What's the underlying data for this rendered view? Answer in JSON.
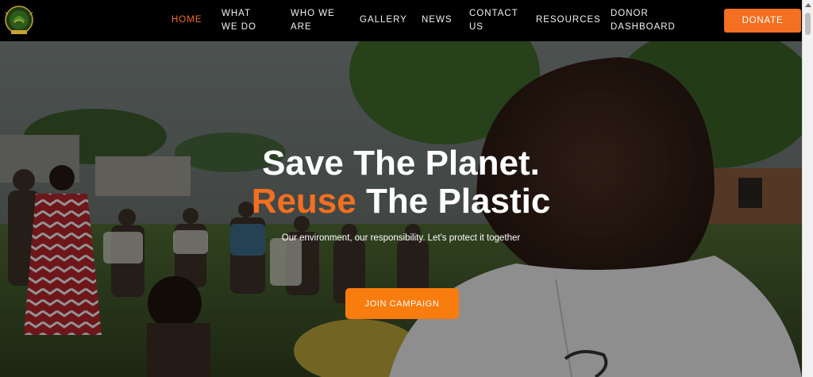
{
  "nav": {
    "items": [
      {
        "label": "HOME",
        "active": true
      },
      {
        "label": "WHAT WE DO"
      },
      {
        "label": "WHO WE ARE"
      },
      {
        "label": "GALLERY"
      },
      {
        "label": "NEWS"
      },
      {
        "label": "CONTACT US"
      },
      {
        "label": "RESOURCES"
      },
      {
        "label": "DONOR DASHBOARD"
      }
    ],
    "donate_label": "DONATE"
  },
  "hero": {
    "title_line1": "Save The Planet.",
    "title_line2_accent": "Reuse",
    "title_line2_rest": " The Plastic",
    "subtitle": "Our environment, our responsibility. Let's protect it together",
    "cta_label": "JOIN CAMPAIGN"
  },
  "colors": {
    "accent": "#f36f21",
    "nav_bg": "#000000",
    "nav_text": "#f2f2f2"
  },
  "icons": {
    "logo": "organization-logo-emblem",
    "scroll_up": "scroll-up-arrow-icon"
  }
}
